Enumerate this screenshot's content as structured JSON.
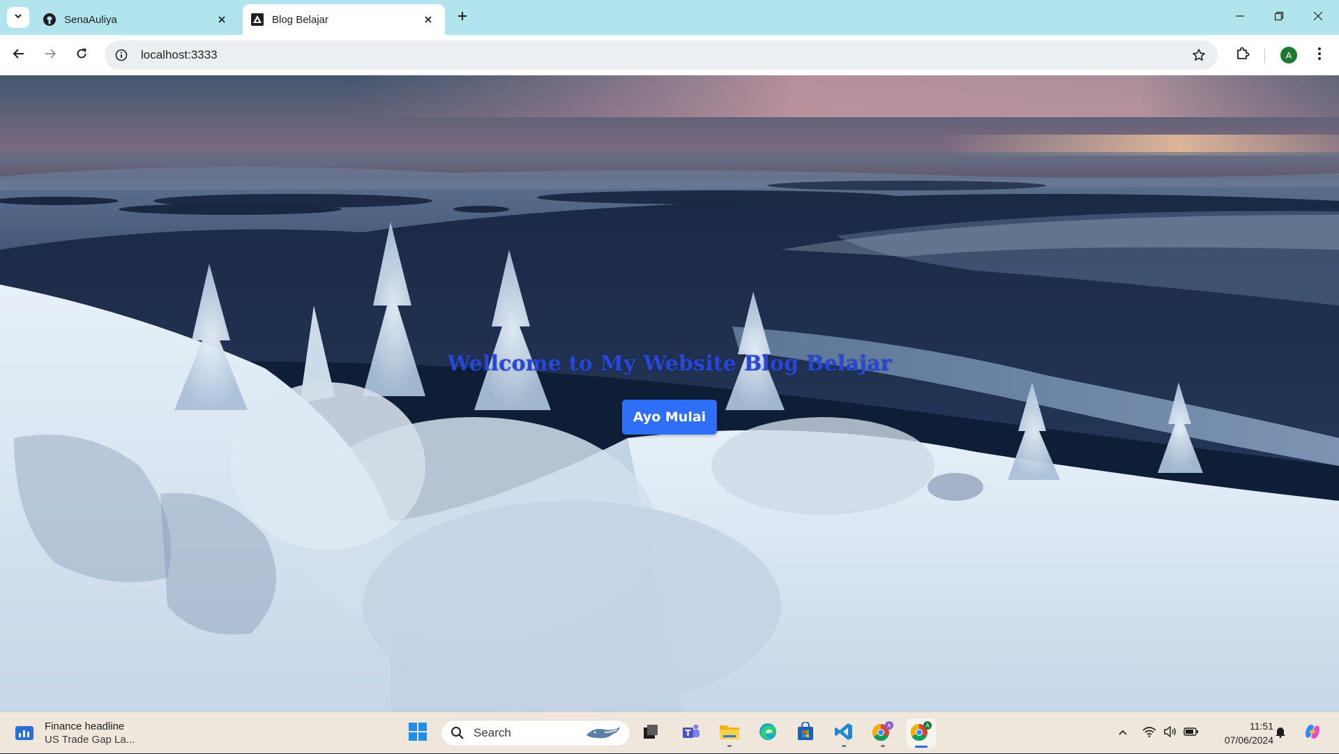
{
  "browser": {
    "tabs": [
      {
        "title": "SenaAuliya",
        "icon": "github-icon",
        "active": false
      },
      {
        "title": "Blog Belajar",
        "icon": "site-triangle-icon",
        "active": true
      }
    ],
    "address": "localhost:3333",
    "profile_initial": "A"
  },
  "page": {
    "heading": "Wellcome to My Website Blog Belajar",
    "cta_label": "Ayo Mulai",
    "colors": {
      "heading": "#2748d6",
      "button": "#2f6ef6"
    }
  },
  "taskbar": {
    "widget": {
      "headline": "Finance headline",
      "subtext": "US Trade Gap La..."
    },
    "search_label": "Search",
    "apps": [
      "start-icon",
      "task-view-icon",
      "teams-icon",
      "file-explorer-icon",
      "edge-icon",
      "store-icon",
      "vscode-icon",
      "chrome-profile-a-icon",
      "chrome-active-icon"
    ],
    "time": "11:51",
    "date": "07/06/2024"
  }
}
